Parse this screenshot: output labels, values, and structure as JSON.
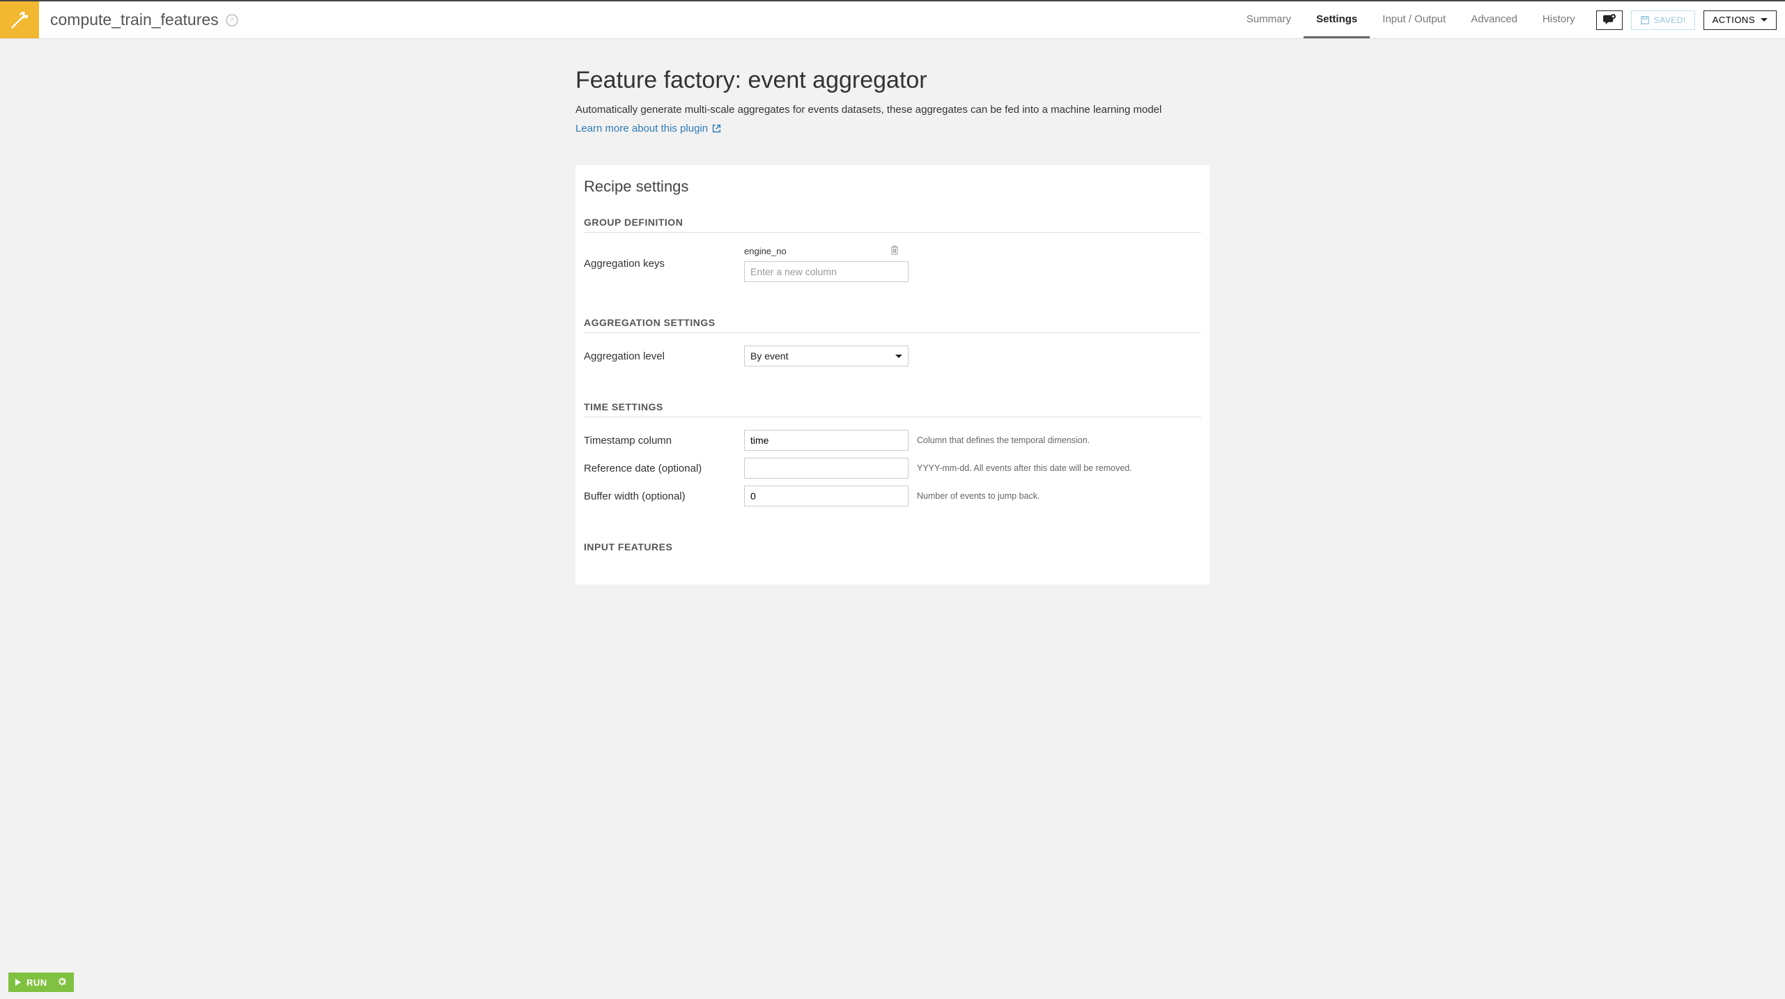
{
  "header": {
    "recipe_name": "compute_train_features",
    "tabs": [
      "Summary",
      "Settings",
      "Input / Output",
      "Advanced",
      "History"
    ],
    "active_tab": "Settings",
    "saved_label": "SAVED!",
    "actions_label": "ACTIONS"
  },
  "page": {
    "title": "Feature factory: event aggregator",
    "description": "Automatically generate multi-scale aggregates for events datasets, these aggregates can be fed into a machine learning model",
    "learn_more": "Learn more about this plugin"
  },
  "panel": {
    "title": "Recipe settings",
    "sections": {
      "group_definition": {
        "header": "GROUP DEFINITION",
        "aggregation_keys_label": "Aggregation keys",
        "aggregation_key_value": "engine_no",
        "new_column_placeholder": "Enter a new column"
      },
      "aggregation_settings": {
        "header": "AGGREGATION SETTINGS",
        "level_label": "Aggregation level",
        "level_value": "By event"
      },
      "time_settings": {
        "header": "TIME SETTINGS",
        "timestamp_label": "Timestamp column",
        "timestamp_value": "time",
        "timestamp_hint": "Column that defines the temporal dimension.",
        "reference_label": "Reference date (optional)",
        "reference_value": "",
        "reference_hint": "YYYY-mm-dd. All events after this date will be removed.",
        "buffer_label": "Buffer width (optional)",
        "buffer_value": "0",
        "buffer_hint": "Number of events to jump back."
      },
      "input_features": {
        "header": "INPUT FEATURES"
      }
    }
  },
  "footer": {
    "run_label": "RUN"
  }
}
